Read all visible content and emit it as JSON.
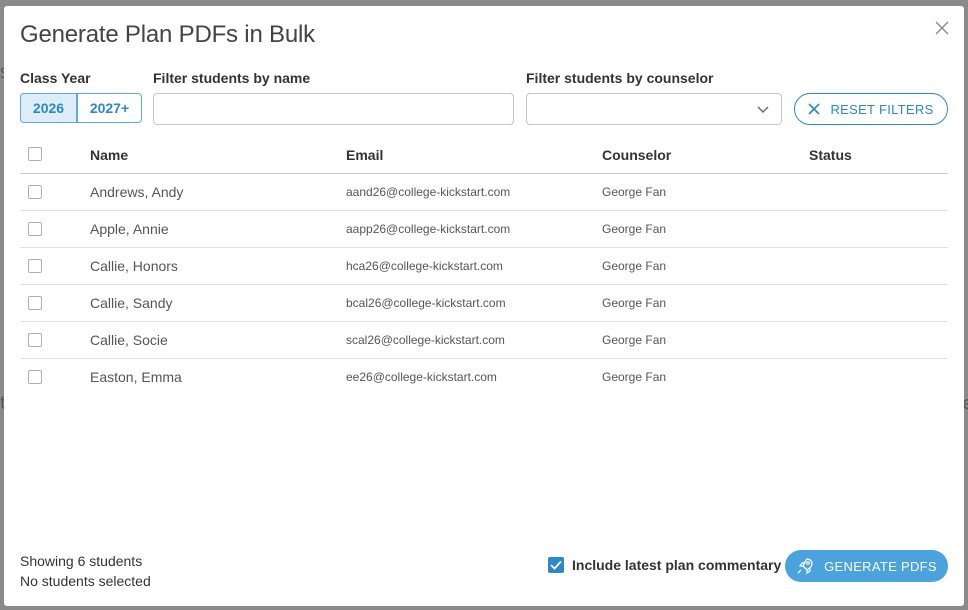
{
  "modal": {
    "title": "Generate Plan PDFs in Bulk"
  },
  "filters": {
    "class_year_label": "Class Year",
    "years": [
      "2026",
      "2027+"
    ],
    "name_label": "Filter students by name",
    "name_value": "",
    "counselor_label": "Filter students by counselor",
    "counselor_value": "",
    "reset_label": "RESET FILTERS"
  },
  "table": {
    "headers": {
      "name": "Name",
      "email": "Email",
      "counselor": "Counselor",
      "status": "Status"
    },
    "rows": [
      {
        "name": "Andrews, Andy",
        "email": "aand26@college-kickstart.com",
        "counselor": "George Fan",
        "status": ""
      },
      {
        "name": "Apple, Annie",
        "email": "aapp26@college-kickstart.com",
        "counselor": "George Fan",
        "status": ""
      },
      {
        "name": "Callie, Honors",
        "email": "hca26@college-kickstart.com",
        "counselor": "George Fan",
        "status": ""
      },
      {
        "name": "Callie, Sandy",
        "email": "bcal26@college-kickstart.com",
        "counselor": "George Fan",
        "status": ""
      },
      {
        "name": "Callie, Socie",
        "email": "scal26@college-kickstart.com",
        "counselor": "George Fan",
        "status": ""
      },
      {
        "name": "Easton, Emma",
        "email": "ee26@college-kickstart.com",
        "counselor": "George Fan",
        "status": ""
      }
    ]
  },
  "footer": {
    "showing": "Showing 6 students",
    "selected": "No students selected",
    "commentary_label": "Include latest plan commentary",
    "commentary_checked": true,
    "generate_label": "GENERATE PDFS"
  },
  "colors": {
    "accent": "#2d88c5",
    "primary_button": "#4aa3dc",
    "active_year_bg": "#ddeef9",
    "overlay": "#8a8a8a"
  },
  "icons": {
    "close": "close-icon",
    "select_chevron": "chevron-down-icon",
    "reset": "x-icon",
    "generate": "rocket-icon",
    "commentary_check": "checkmark-icon"
  }
}
